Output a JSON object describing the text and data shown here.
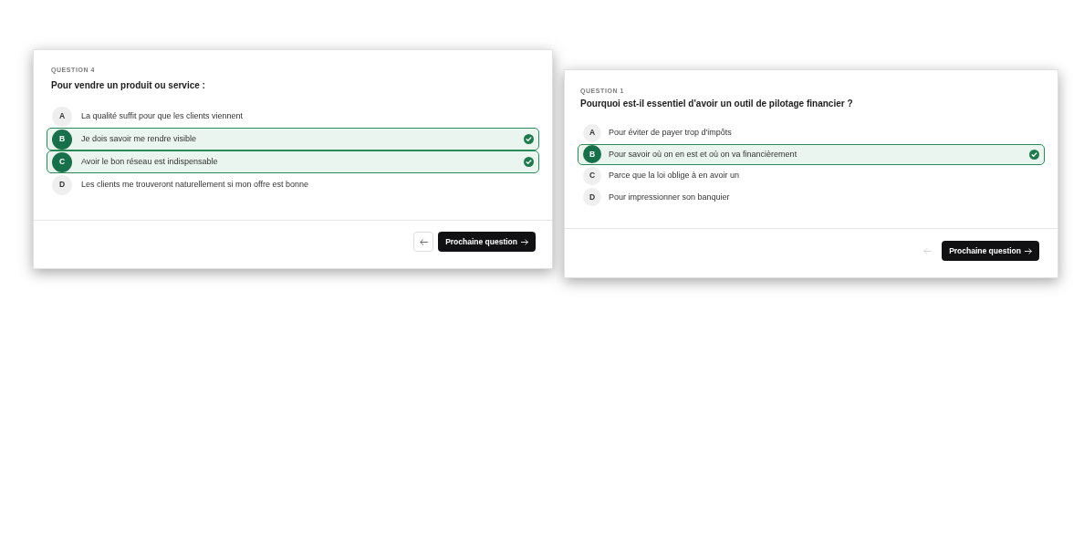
{
  "cards": [
    {
      "eyebrow": "QUESTION 4",
      "question": "Pour vendre un produit ou service :",
      "options": [
        {
          "letter": "A",
          "text": "La qualité suffit pour que les clients viennent",
          "selected": false
        },
        {
          "letter": "B",
          "text": "Je dois savoir me rendre visible",
          "selected": true
        },
        {
          "letter": "C",
          "text": "Avoir le bon réseau est indispensable",
          "selected": true
        },
        {
          "letter": "D",
          "text": "Les clients me trouveront naturellement si mon offre est bonne",
          "selected": false
        }
      ],
      "back_button": {
        "disabled": false
      },
      "next_button": {
        "label": "Prochaine question"
      }
    },
    {
      "eyebrow": "QUESTION 1",
      "question": "Pourquoi est-il essentiel d'avoir un outil de pilotage financier ?",
      "options": [
        {
          "letter": "A",
          "text": "Pour éviter de payer trop d'impôts",
          "selected": false
        },
        {
          "letter": "B",
          "text": "Pour savoir où on en est et où on va financièrement",
          "selected": true
        },
        {
          "letter": "C",
          "text": "Parce que la loi oblige à en avoir un",
          "selected": false
        },
        {
          "letter": "D",
          "text": "Pour impressionner son banquier",
          "selected": false
        }
      ],
      "back_button": {
        "disabled": true
      },
      "next_button": {
        "label": "Prochaine question"
      }
    }
  ]
}
